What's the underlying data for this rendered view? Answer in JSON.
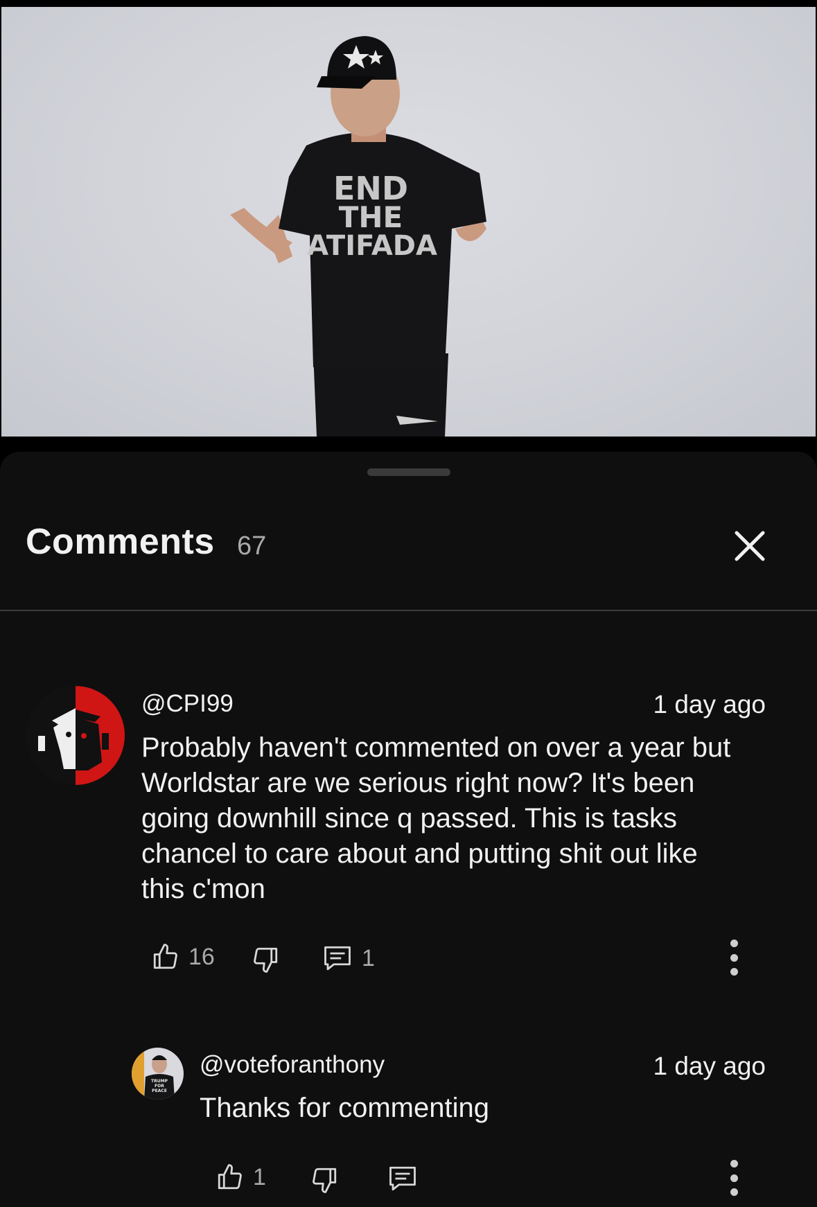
{
  "sheet": {
    "title": "Comments",
    "count": "67"
  },
  "comments": [
    {
      "handle": "@CPI99",
      "time": "1 day ago",
      "text": "Probably haven't commented on over a year but Worldstar are we serious right now? It's been going downhill since q passed. This is tasks chancel to care about and putting shit out like this c'mon",
      "lines": [
        "Probably haven't commented on over a year but",
        "Worldstar are we serious right now? It's been",
        "going downhill since q passed. This is tasks",
        "chancel to care about and putting shit out like",
        "this c'mon"
      ],
      "likes": "16",
      "replies": "1"
    },
    {
      "handle": "@voteforanthony",
      "time": "1 day ago",
      "text": "Thanks for commenting",
      "likes": "1"
    }
  ],
  "video": {
    "shirt_lines": [
      "END",
      "THE",
      "ATIFADA"
    ],
    "avatar_reply_shirt": [
      "TRUMP",
      "FOR",
      "PEACE"
    ]
  },
  "colors": {
    "sheet_bg": "#0f0f0f",
    "text_primary": "#f1f1f1",
    "text_secondary": "#aaaaaa",
    "divider": "#3d3d3d",
    "avatar_red": "#d01515"
  }
}
